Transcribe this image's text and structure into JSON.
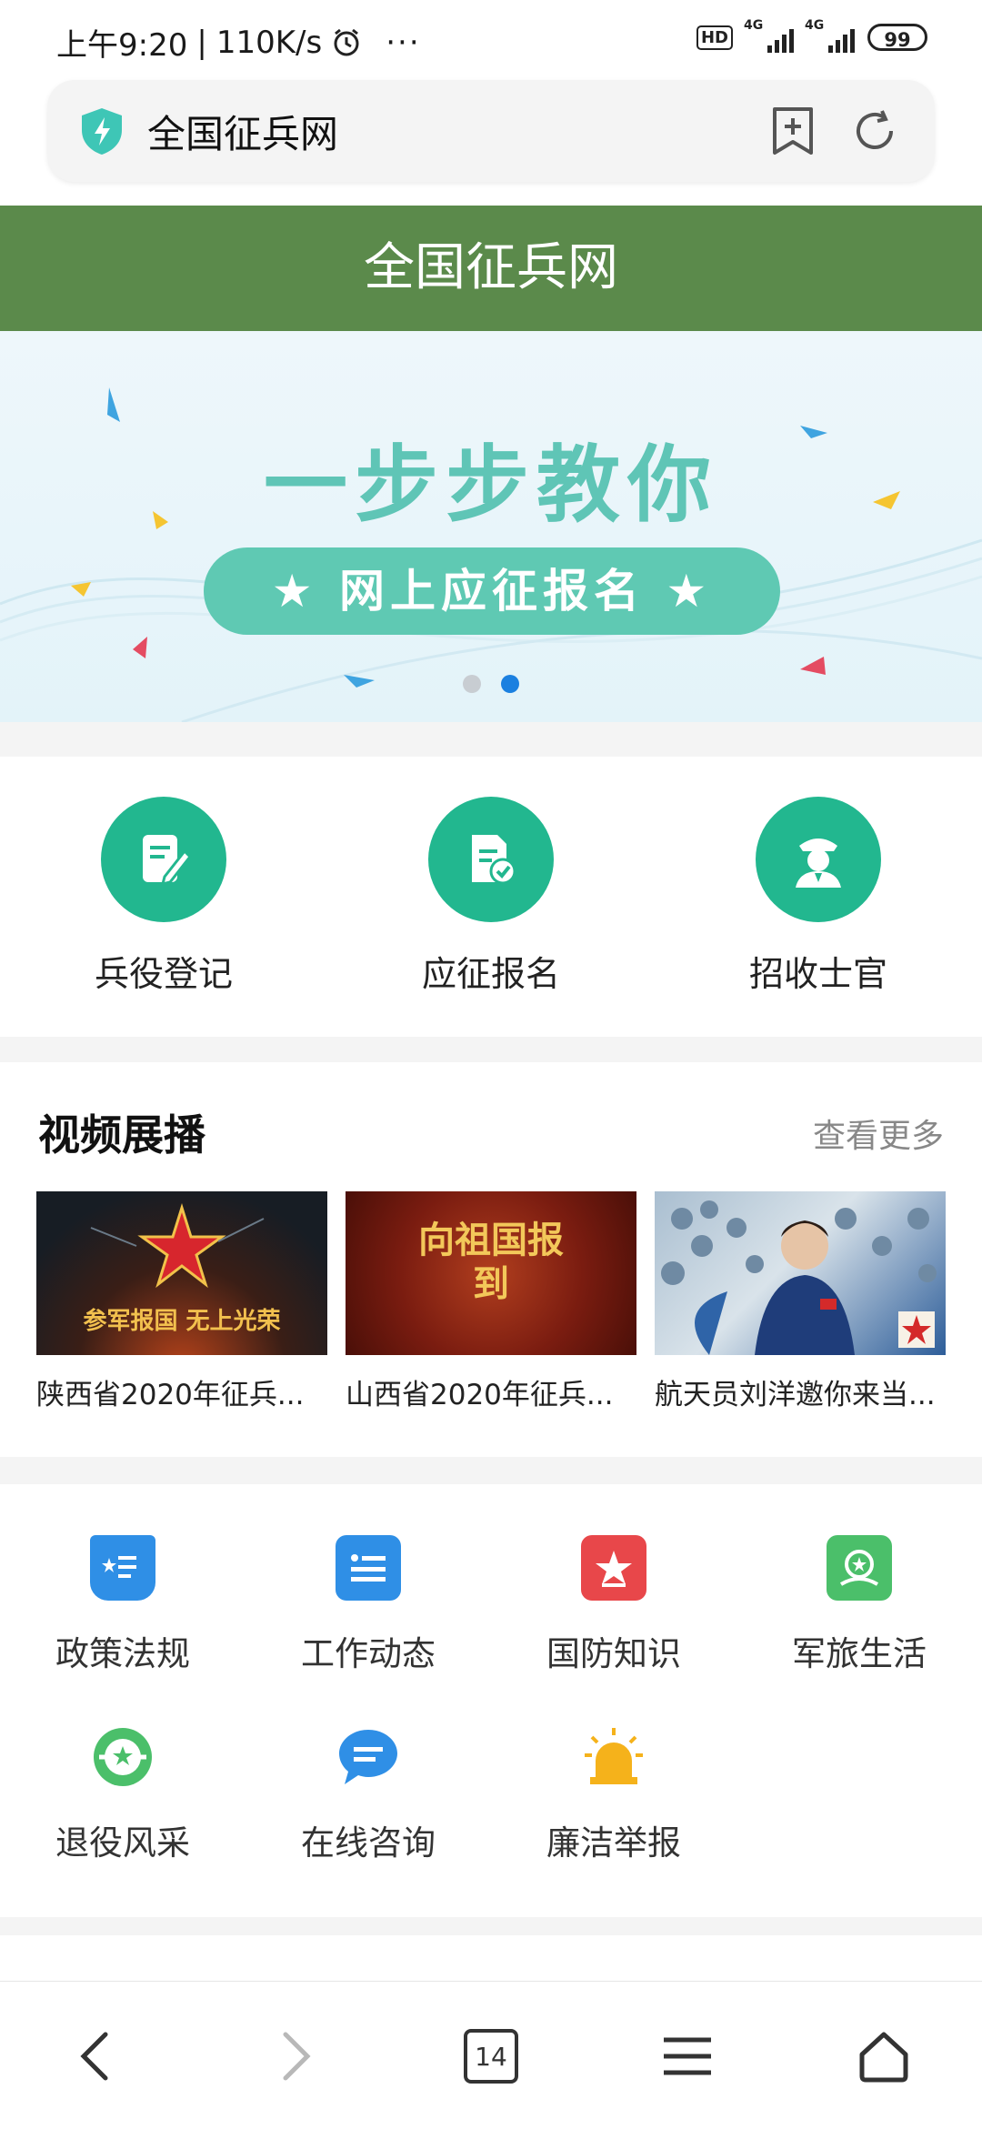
{
  "status": {
    "time": "上午9:20",
    "speed": "110K/s",
    "more": "···",
    "hd": "HD",
    "net1": "4G",
    "net2": "4G",
    "battery": "99"
  },
  "address": {
    "text": "全国征兵网"
  },
  "site": {
    "title": "全国征兵网"
  },
  "banner": {
    "headline": "一步步教你",
    "pill": "★ 网上应征报名 ★",
    "dots_total": 2,
    "dots_active": 2
  },
  "services": [
    {
      "label": "兵役登记",
      "icon": "form-edit-icon"
    },
    {
      "label": "应征报名",
      "icon": "document-check-icon"
    },
    {
      "label": "招收士官",
      "icon": "officer-icon"
    }
  ],
  "video": {
    "title": "视频展播",
    "more": "查看更多",
    "items": [
      {
        "caption": "陕西省2020年征兵...",
        "thumb_text": "参军报国  无上光荣"
      },
      {
        "caption": "山西省2020年征兵...",
        "thumb_text": "向祖国报到"
      },
      {
        "caption": "航天员刘洋邀你来当..."
      }
    ]
  },
  "grid": [
    {
      "label": "政策法规",
      "icon": "policy-book-icon",
      "color": "#2f8fe6"
    },
    {
      "label": "工作动态",
      "icon": "news-list-icon",
      "color": "#2f8fe6"
    },
    {
      "label": "国防知识",
      "icon": "defense-star-icon",
      "color": "#e8474a"
    },
    {
      "label": "军旅生活",
      "icon": "military-life-icon",
      "color": "#4bbf6a"
    },
    {
      "label": "退役风采",
      "icon": "veteran-badge-icon",
      "color": "#4bbf6a"
    },
    {
      "label": "在线咨询",
      "icon": "chat-bubble-icon",
      "color": "#2f8fe6"
    },
    {
      "label": "廉洁举报",
      "icon": "alarm-light-icon",
      "color": "#f5b21b"
    }
  ],
  "nav": {
    "tabs_count": "14"
  }
}
